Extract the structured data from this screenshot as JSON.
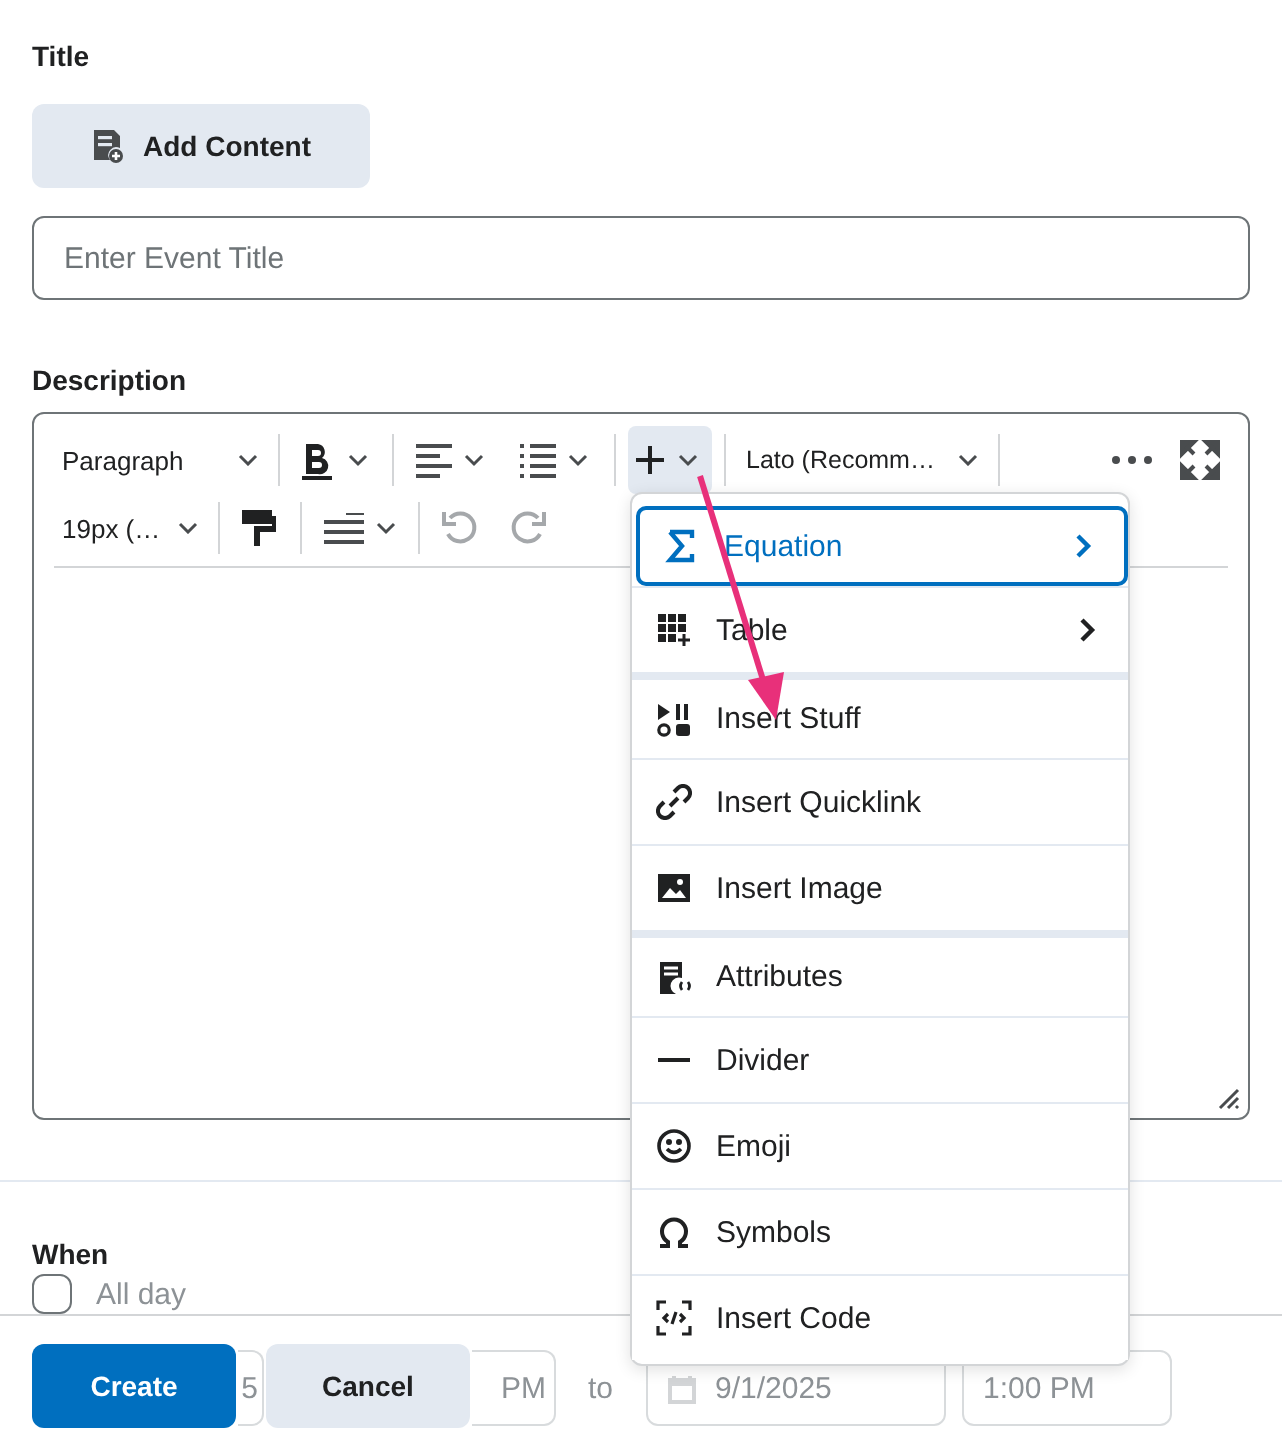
{
  "title_label": "Title",
  "add_content_button": "Add Content",
  "title_field": {
    "placeholder": "Enter Event Title"
  },
  "description_label": "Description",
  "toolbar": {
    "paragraph": "Paragraph",
    "font": "Lato (Recomm…",
    "size": "19px (…",
    "insert_open": true,
    "undo_disabled": true,
    "redo_disabled": true
  },
  "insert_menu": [
    {
      "label": "Equation",
      "kind": "equation",
      "focused": true,
      "submenu": true,
      "group_start": false
    },
    {
      "label": "Table",
      "kind": "table",
      "focused": false,
      "submenu": true,
      "group_start": false
    },
    {
      "label": "Insert Stuff",
      "kind": "stuff",
      "focused": false,
      "submenu": false,
      "group_start": true
    },
    {
      "label": "Insert Quicklink",
      "kind": "quicklink",
      "focused": false,
      "submenu": false,
      "group_start": false
    },
    {
      "label": "Insert Image",
      "kind": "image",
      "focused": false,
      "submenu": false,
      "group_start": false
    },
    {
      "label": "Attributes",
      "kind": "attributes",
      "focused": false,
      "submenu": false,
      "group_start": true
    },
    {
      "label": "Divider",
      "kind": "divider",
      "focused": false,
      "submenu": false,
      "group_start": false
    },
    {
      "label": "Emoji",
      "kind": "emoji",
      "focused": false,
      "submenu": false,
      "group_start": false
    },
    {
      "label": "Symbols",
      "kind": "symbols",
      "focused": false,
      "submenu": false,
      "group_start": false
    },
    {
      "label": "Insert Code",
      "kind": "code",
      "focused": false,
      "submenu": false,
      "group_start": false
    }
  ],
  "when": {
    "label": "When",
    "all_day": {
      "label": "All day",
      "checked": false
    },
    "start_date": "5",
    "start_time": "PM",
    "to": "to",
    "end_date": "9/1/2025",
    "end_time": "1:00 PM"
  },
  "buttons": [
    {
      "label": "Create",
      "kind": "primary"
    },
    {
      "label": "Cancel",
      "kind": "secondary"
    }
  ]
}
